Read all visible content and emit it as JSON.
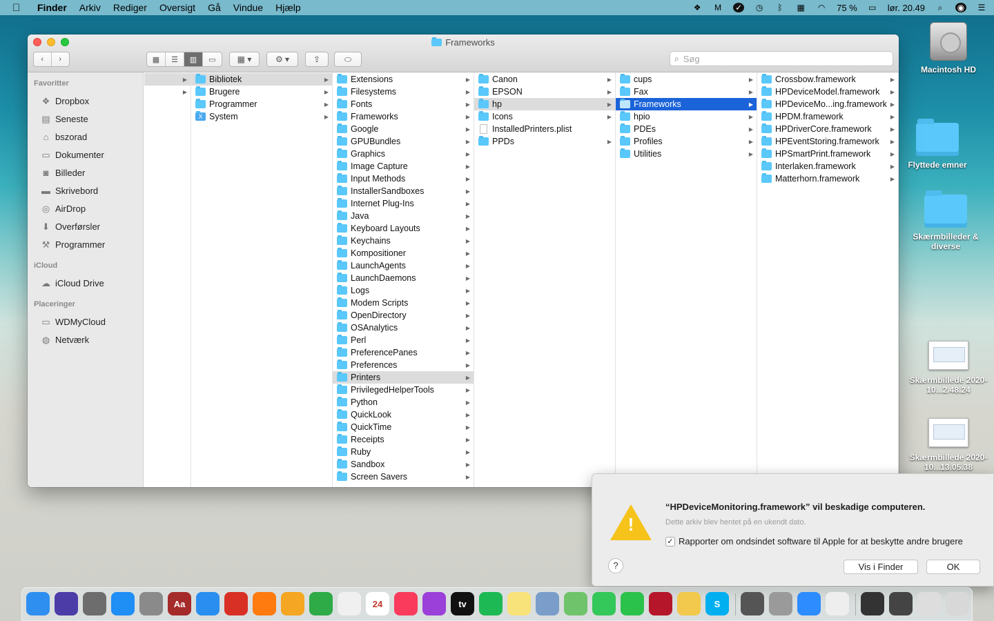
{
  "menubar": {
    "app": "Finder",
    "items": [
      "Arkiv",
      "Rediger",
      "Oversigt",
      "Gå",
      "Vindue",
      "Hjælp"
    ],
    "battery": "75 %",
    "clock": "lør. 20.49"
  },
  "desktop": {
    "items": [
      {
        "label": "Macintosh HD",
        "icon": "hard-drive-icon"
      },
      {
        "label": "Flyttede emner",
        "icon": "folder-icon"
      },
      {
        "label": "Skærmbilleder & diverse",
        "icon": "folder-icon"
      },
      {
        "label": "Skærmbillede 2020-10...2.48.24",
        "icon": "screenshot-icon"
      },
      {
        "label": "Skærmbillede 2020-10...13.05.38",
        "icon": "screenshot-icon"
      }
    ]
  },
  "window": {
    "title": "Frameworks",
    "search_placeholder": "Søg"
  },
  "sidebar": {
    "sections": [
      {
        "title": "Favoritter",
        "items": [
          {
            "label": "Dropbox",
            "icon": "dropbox-icon",
            "glyph": "❖"
          },
          {
            "label": "Seneste",
            "icon": "recents-icon",
            "glyph": "▤"
          },
          {
            "label": "bszorad",
            "icon": "home-icon",
            "glyph": "⌂"
          },
          {
            "label": "Dokumenter",
            "icon": "documents-icon",
            "glyph": "▭"
          },
          {
            "label": "Billeder",
            "icon": "pictures-icon",
            "glyph": "◙"
          },
          {
            "label": "Skrivebord",
            "icon": "desktop-icon",
            "glyph": "▬"
          },
          {
            "label": "AirDrop",
            "icon": "airdrop-icon",
            "glyph": "◎"
          },
          {
            "label": "Overførsler",
            "icon": "downloads-icon",
            "glyph": "⬇"
          },
          {
            "label": "Programmer",
            "icon": "applications-icon",
            "glyph": "⚒"
          }
        ]
      },
      {
        "title": "iCloud",
        "items": [
          {
            "label": "iCloud Drive",
            "icon": "cloud-icon",
            "glyph": "☁"
          }
        ]
      },
      {
        "title": "Placeringer",
        "items": [
          {
            "label": "WDMyCloud",
            "icon": "monitor-icon",
            "glyph": "▭"
          },
          {
            "label": "Netværk",
            "icon": "network-icon",
            "glyph": "◍"
          }
        ]
      }
    ]
  },
  "columns": [
    {
      "items": []
    },
    {
      "items": [
        {
          "label": "Bibliotek",
          "arrow": true,
          "sel": "grey",
          "kind": "folder"
        },
        {
          "label": "Brugere",
          "arrow": true,
          "kind": "folder"
        },
        {
          "label": "Programmer",
          "arrow": true,
          "kind": "folder"
        },
        {
          "label": "System",
          "arrow": true,
          "kind": "sysx"
        }
      ]
    },
    {
      "items": [
        {
          "label": "Extensions",
          "arrow": true
        },
        {
          "label": "Filesystems",
          "arrow": true
        },
        {
          "label": "Fonts",
          "arrow": true
        },
        {
          "label": "Frameworks",
          "arrow": true
        },
        {
          "label": "Google",
          "arrow": true
        },
        {
          "label": "GPUBundles",
          "arrow": true
        },
        {
          "label": "Graphics",
          "arrow": true
        },
        {
          "label": "Image Capture",
          "arrow": true
        },
        {
          "label": "Input Methods",
          "arrow": true
        },
        {
          "label": "InstallerSandboxes",
          "arrow": true
        },
        {
          "label": "Internet Plug-Ins",
          "arrow": true
        },
        {
          "label": "Java",
          "arrow": true
        },
        {
          "label": "Keyboard Layouts",
          "arrow": true
        },
        {
          "label": "Keychains",
          "arrow": true
        },
        {
          "label": "Kompositioner",
          "arrow": true
        },
        {
          "label": "LaunchAgents",
          "arrow": true
        },
        {
          "label": "LaunchDaemons",
          "arrow": true
        },
        {
          "label": "Logs",
          "arrow": true
        },
        {
          "label": "Modem Scripts",
          "arrow": true
        },
        {
          "label": "OpenDirectory",
          "arrow": true
        },
        {
          "label": "OSAnalytics",
          "arrow": true
        },
        {
          "label": "Perl",
          "arrow": true
        },
        {
          "label": "PreferencePanes",
          "arrow": true
        },
        {
          "label": "Preferences",
          "arrow": true
        },
        {
          "label": "Printers",
          "arrow": true,
          "sel": "grey"
        },
        {
          "label": "PrivilegedHelperTools",
          "arrow": true
        },
        {
          "label": "Python",
          "arrow": true
        },
        {
          "label": "QuickLook",
          "arrow": true
        },
        {
          "label": "QuickTime",
          "arrow": true
        },
        {
          "label": "Receipts",
          "arrow": true
        },
        {
          "label": "Ruby",
          "arrow": true
        },
        {
          "label": "Sandbox",
          "arrow": true
        },
        {
          "label": "Screen Savers",
          "arrow": true
        }
      ]
    },
    {
      "items": [
        {
          "label": "Canon",
          "arrow": true
        },
        {
          "label": "EPSON",
          "arrow": true
        },
        {
          "label": "hp",
          "arrow": true,
          "sel": "grey"
        },
        {
          "label": "Icons",
          "arrow": true
        },
        {
          "label": "InstalledPrinters.plist",
          "arrow": false,
          "kind": "doc"
        },
        {
          "label": "PPDs",
          "arrow": true
        }
      ]
    },
    {
      "items": [
        {
          "label": "cups",
          "arrow": true
        },
        {
          "label": "Fax",
          "arrow": true
        },
        {
          "label": "Frameworks",
          "arrow": true,
          "sel": "blue"
        },
        {
          "label": "hpio",
          "arrow": true
        },
        {
          "label": "PDEs",
          "arrow": true
        },
        {
          "label": "Profiles",
          "arrow": true
        },
        {
          "label": "Utilities",
          "arrow": true
        }
      ]
    },
    {
      "items": [
        {
          "label": "Crossbow.framework",
          "arrow": true
        },
        {
          "label": "HPDeviceModel.framework",
          "arrow": true
        },
        {
          "label": "HPDeviceMo...ing.framework",
          "arrow": true
        },
        {
          "label": "HPDM.framework",
          "arrow": true
        },
        {
          "label": "HPDriverCore.framework",
          "arrow": true
        },
        {
          "label": "HPEventStoring.framework",
          "arrow": true
        },
        {
          "label": "HPSmartPrint.framework",
          "arrow": true
        },
        {
          "label": "Interlaken.framework",
          "arrow": true
        },
        {
          "label": "Matterhorn.framework",
          "arrow": true
        }
      ]
    }
  ],
  "alert": {
    "title": "“HPDeviceMonitoring.framework” vil beskadige computeren.",
    "subtitle": "Dette arkiv blev hentet på en ukendt dato.",
    "checkbox_label": "Rapporter om ondsindet software til Apple for at beskytte andre brugere",
    "checkbox_checked": true,
    "help": "?",
    "show_in_finder": "Vis i Finder",
    "ok": "OK"
  },
  "dock": {
    "apps": [
      {
        "name": "finder",
        "color": "#2f8ff0"
      },
      {
        "name": "siri",
        "color": "#4b3ca8"
      },
      {
        "name": "system-preferences",
        "color": "#6d6d6d"
      },
      {
        "name": "app-store",
        "color": "#1f8ef5"
      },
      {
        "name": "launchpad",
        "color": "#8a8a8a"
      },
      {
        "name": "dictionary",
        "color": "#a52a2a",
        "glyph": "Aa"
      },
      {
        "name": "safari",
        "color": "#2a8ef0"
      },
      {
        "name": "chrome",
        "color": "#d93025"
      },
      {
        "name": "firefox",
        "color": "#ff7b10"
      },
      {
        "name": "pages",
        "color": "#f5a623"
      },
      {
        "name": "numbers",
        "color": "#2eaa46"
      },
      {
        "name": "textedit",
        "color": "#f0f0f0"
      },
      {
        "name": "calendar",
        "color": "#ffffff",
        "glyph": "24"
      },
      {
        "name": "music",
        "color": "#fa3b5c"
      },
      {
        "name": "podcasts",
        "color": "#9b40d8"
      },
      {
        "name": "apple-tv",
        "color": "#111111",
        "glyph": "tv"
      },
      {
        "name": "spotify",
        "color": "#1db954"
      },
      {
        "name": "notes",
        "color": "#f8e27a"
      },
      {
        "name": "preview",
        "color": "#7a9ec9"
      },
      {
        "name": "maps",
        "color": "#6fc36a"
      },
      {
        "name": "messages",
        "color": "#34c759"
      },
      {
        "name": "facetime",
        "color": "#2bc24b"
      },
      {
        "name": "photo-booth",
        "color": "#b5162a"
      },
      {
        "name": "photos",
        "color": "#f2c94c"
      },
      {
        "name": "skype",
        "color": "#00aff0",
        "glyph": "S"
      },
      {
        "name": "calculator",
        "color": "#555555"
      },
      {
        "name": "disk-utility",
        "color": "#9a9a9a"
      },
      {
        "name": "zoom",
        "color": "#2d8cff"
      },
      {
        "name": "document",
        "color": "#eeeeee"
      },
      {
        "name": "screenshot-1",
        "color": "#333333"
      },
      {
        "name": "screenshot-2",
        "color": "#444444"
      },
      {
        "name": "screenshot-3",
        "color": "#dddddd"
      },
      {
        "name": "trash",
        "color": "#d8d8d8"
      }
    ]
  }
}
